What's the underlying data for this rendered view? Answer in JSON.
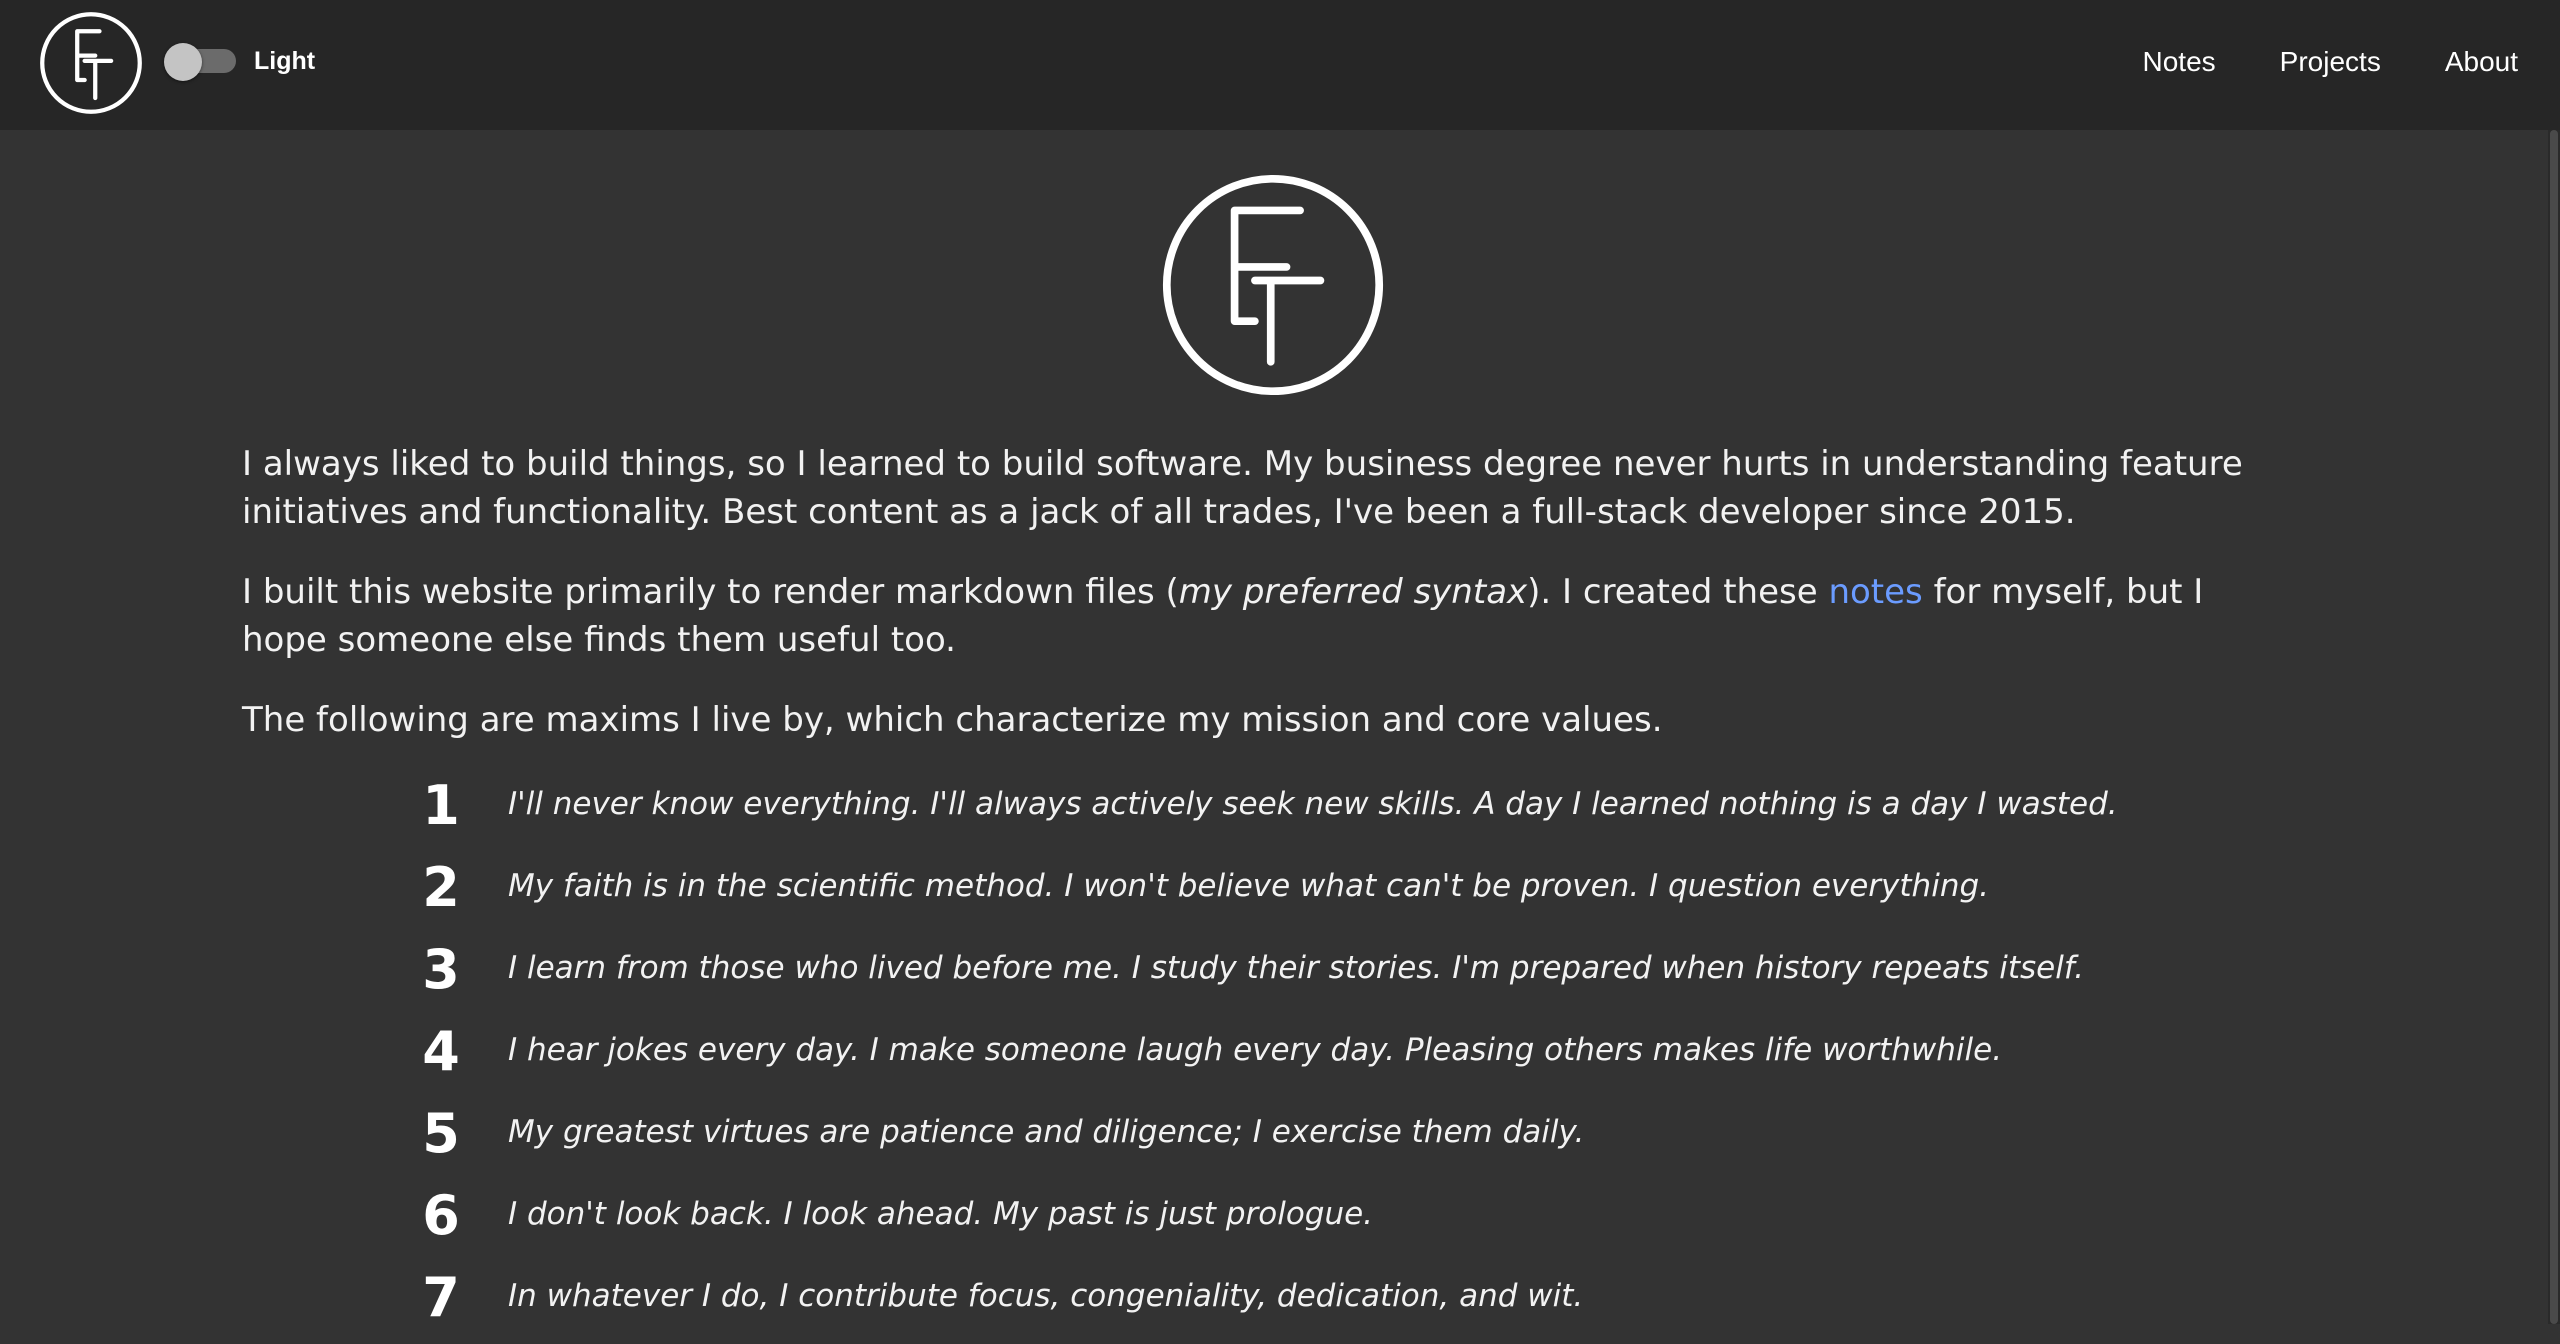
{
  "header": {
    "logo_icon": "ef-monogram-icon",
    "theme_toggle_label": "Light",
    "nav": [
      {
        "label": "Notes"
      },
      {
        "label": "Projects"
      },
      {
        "label": "About"
      }
    ]
  },
  "main": {
    "hero_icon": "ef-monogram-icon",
    "intro": "I always liked to build things, so I learned to build software. My business degree never hurts in understanding feature initiatives and functionality. Best content as a jack of all trades, I've been a full-stack developer since 2015.",
    "markdown_para": {
      "before": "I built this website primarily to render markdown files (",
      "emphasis": "my preferred syntax",
      "middle": "). I created these ",
      "link": "notes",
      "after": " for myself, but I hope someone else finds them useful too."
    },
    "maxims_intro": "The following are maxims I live by, which characterize my mission and core values.",
    "maxims": [
      {
        "num": "1",
        "text": "I'll never know everything. I'll always actively seek new skills. A day I learned nothing is a day I wasted."
      },
      {
        "num": "2",
        "text": "My faith is in the scientific method. I won't believe what can't be proven. I question everything."
      },
      {
        "num": "3",
        "text": "I learn from those who lived before me. I study their stories. I'm prepared when history repeats itself."
      },
      {
        "num": "4",
        "text": "I hear jokes every day. I make someone laugh every day. Pleasing others makes life worthwhile."
      },
      {
        "num": "5",
        "text": "My greatest virtues are patience and diligence; I exercise them daily."
      },
      {
        "num": "6",
        "text": "I don't look back. I look ahead. My past is just prologue."
      },
      {
        "num": "7",
        "text": "In whatever I do, I contribute focus, congeniality, dedication, and wit."
      }
    ]
  },
  "colors": {
    "header_bg": "#262626",
    "page_bg": "#333333",
    "link": "#6b9cff",
    "text": "#f2f2f2"
  }
}
